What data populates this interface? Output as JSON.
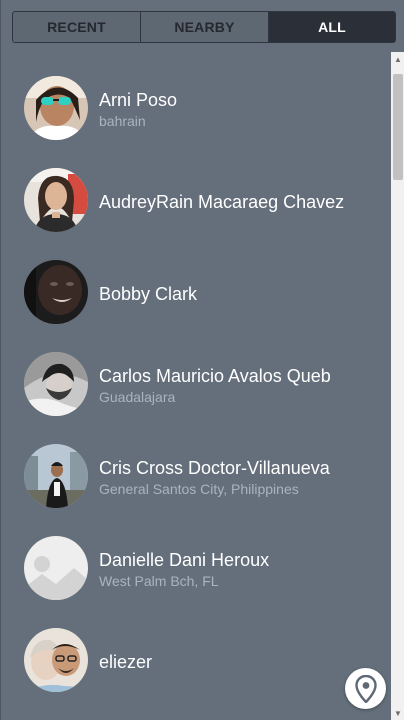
{
  "tabs": [
    {
      "label": "RECENT",
      "active": false
    },
    {
      "label": "NEARBY",
      "active": false
    },
    {
      "label": "ALL",
      "active": true
    }
  ],
  "people": [
    {
      "name": "Arni Poso",
      "location": "bahrain",
      "avatar": "photo-avatar"
    },
    {
      "name": "AudreyRain Macaraeg Chavez",
      "location": "",
      "avatar": "photo-avatar"
    },
    {
      "name": "Bobby Clark",
      "location": "",
      "avatar": "photo-avatar"
    },
    {
      "name": "Carlos Mauricio Avalos Queb",
      "location": "Guadalajara",
      "avatar": "photo-avatar"
    },
    {
      "name": "Cris Cross Doctor-Villanueva",
      "location": "General Santos City, Philippines",
      "avatar": "photo-avatar"
    },
    {
      "name": "Danielle Dani Heroux",
      "location": "West Palm Bch, FL",
      "avatar": "placeholder-image-icon"
    },
    {
      "name": "eliezer",
      "location": "",
      "avatar": "photo-avatar"
    }
  ],
  "fab": {
    "icon": "map-pin-icon"
  },
  "colors": {
    "background": "#646f7b",
    "active_tab": "#2a2f38",
    "secondary_text": "#a9b4bf"
  }
}
